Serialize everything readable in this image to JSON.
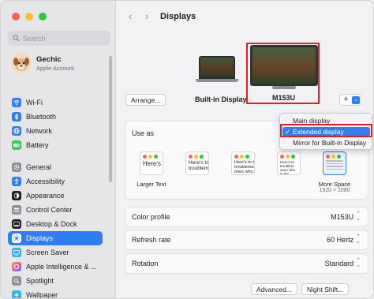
{
  "window": {
    "title": "Displays"
  },
  "sidebar": {
    "search_placeholder": "Search",
    "account": {
      "name": "Gechic",
      "subtitle": "Apple Account"
    },
    "groups": [
      [
        {
          "label": "Wi-Fi",
          "icon": "wifi-icon",
          "color": "#2f7ff2"
        },
        {
          "label": "Bluetooth",
          "icon": "bluetooth-icon",
          "color": "#2f7ff2"
        },
        {
          "label": "Network",
          "icon": "globe-icon",
          "color": "#2f7ff2"
        },
        {
          "label": "Battery",
          "icon": "battery-icon",
          "color": "#34c759"
        }
      ],
      [
        {
          "label": "General",
          "icon": "gear-icon",
          "color": "#8e8e93"
        },
        {
          "label": "Accessibility",
          "icon": "accessibility-icon",
          "color": "#2f7ff2"
        },
        {
          "label": "Appearance",
          "icon": "appearance-icon",
          "color": "#1d1d1f"
        },
        {
          "label": "Control Center",
          "icon": "control-center-icon",
          "color": "#8e8e93"
        },
        {
          "label": "Desktop & Dock",
          "icon": "dock-icon",
          "color": "#1d1d1f"
        },
        {
          "label": "Displays",
          "icon": "sun-icon",
          "color": "#2f7ff2",
          "active": true
        },
        {
          "label": "Screen Saver",
          "icon": "screen-saver-icon",
          "color": "#33b5e5"
        },
        {
          "label": "Apple Intelligence & ...",
          "icon": "apple-intelligence-icon",
          "color": "#e0609b"
        },
        {
          "label": "Spotlight",
          "icon": "spotlight-icon",
          "color": "#8e8e93"
        },
        {
          "label": "Wallpaper",
          "icon": "wallpaper-icon",
          "color": "#33b5e5"
        }
      ]
    ]
  },
  "displays": {
    "arrange_label": "Arrange...",
    "builtin_label": "Built-in Display",
    "external_label": "M153U",
    "add_label": "+",
    "menu": {
      "items": [
        "Main display",
        "Extended display",
        "Mirror for Built-in Display"
      ],
      "selected": "Extended display",
      "check": "✓"
    },
    "use_as": {
      "title": "Use as",
      "thumbs": [
        {
          "text": "Here's",
          "label": "Larger Text",
          "sub": ""
        },
        {
          "text": "Here's to\ntroublem",
          "label": "",
          "sub": ""
        },
        {
          "text": "Here's to t\ntroublema\nones who",
          "label": "",
          "sub": ""
        },
        {
          "text": "Here's to\ntroublem\nones who\nin the",
          "label": "",
          "sub": ""
        },
        {
          "text": "",
          "label": "More Space",
          "sub": "1920 × 1080",
          "selected": true
        }
      ]
    },
    "rows": [
      {
        "label": "Color profile",
        "value": "M153U"
      },
      {
        "label": "Refresh rate",
        "value": "60 Hertz"
      },
      {
        "label": "Rotation",
        "value": "Standard"
      }
    ],
    "advanced_label": "Advanced...",
    "night_shift_label": "Night Shift..."
  },
  "colors": {
    "accent": "#2f7ff2",
    "highlight_box": "#e02020"
  }
}
